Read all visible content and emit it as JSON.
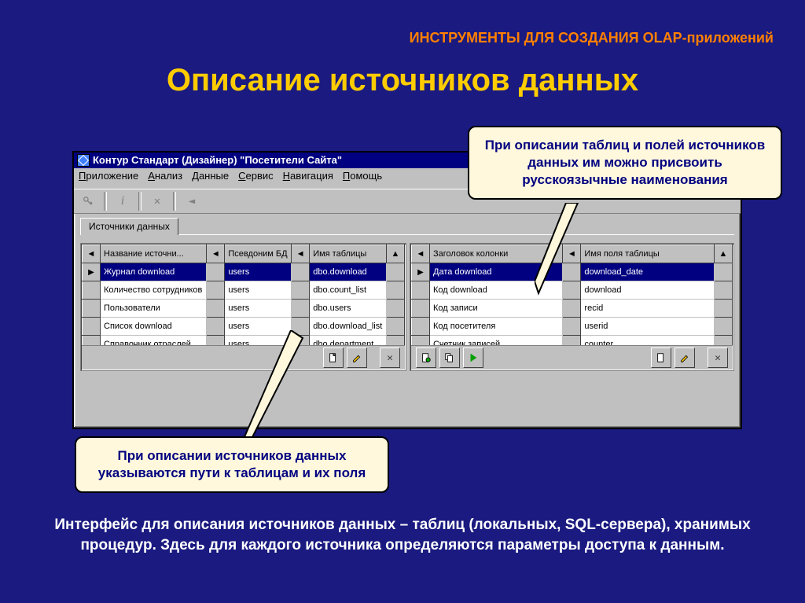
{
  "header": "ИНСТРУМЕНТЫ ДЛЯ СОЗДАНИЯ OLAP-приложений",
  "title": "Описание источников данных",
  "window": {
    "title": "Контур Стандарт (Дизайнер) \"Посетители Сайта\""
  },
  "menu": {
    "app": "Приложение",
    "analysis": "Анализ",
    "data": "Данные",
    "service": "Сервис",
    "nav": "Навигация",
    "help": "Помощь"
  },
  "tab": {
    "sources": "Источники данных"
  },
  "left_table": {
    "headers": {
      "name": "Название источни...",
      "alias": "Псевдоним БД",
      "table": "Имя таблицы"
    },
    "rows": [
      {
        "name": "Журнал download",
        "alias": "users",
        "table": "dbo.download"
      },
      {
        "name": "Количество сотрудников",
        "alias": "users",
        "table": "dbo.count_list"
      },
      {
        "name": "Пользователи",
        "alias": "users",
        "table": "dbo.users"
      },
      {
        "name": "Список download",
        "alias": "users",
        "table": "dbo.download_list"
      },
      {
        "name": "Справочник отраслей",
        "alias": "users",
        "table": "dbo.department"
      }
    ]
  },
  "right_table": {
    "headers": {
      "col": "Заголовок колонки",
      "field": "Имя поля таблицы"
    },
    "rows": [
      {
        "col": "Дата download",
        "field": "download_date"
      },
      {
        "col": "Код download",
        "field": "download"
      },
      {
        "col": "Код записи",
        "field": "recid"
      },
      {
        "col": "Код посетителя",
        "field": "userid"
      },
      {
        "col": "Счетчик записей",
        "field": "counter"
      }
    ]
  },
  "callouts": {
    "top": "При описании таблиц и полей источников данных им можно присвоить русскоязычные наименования",
    "bottom": "При описании источников данных указываются пути к таблицам и их поля"
  },
  "footer": "Интерфейс для описания источников данных – таблиц (локальных, SQL-сервера), хранимых процедур.  Здесь для каждого источника определяются параметры доступа к  данным."
}
